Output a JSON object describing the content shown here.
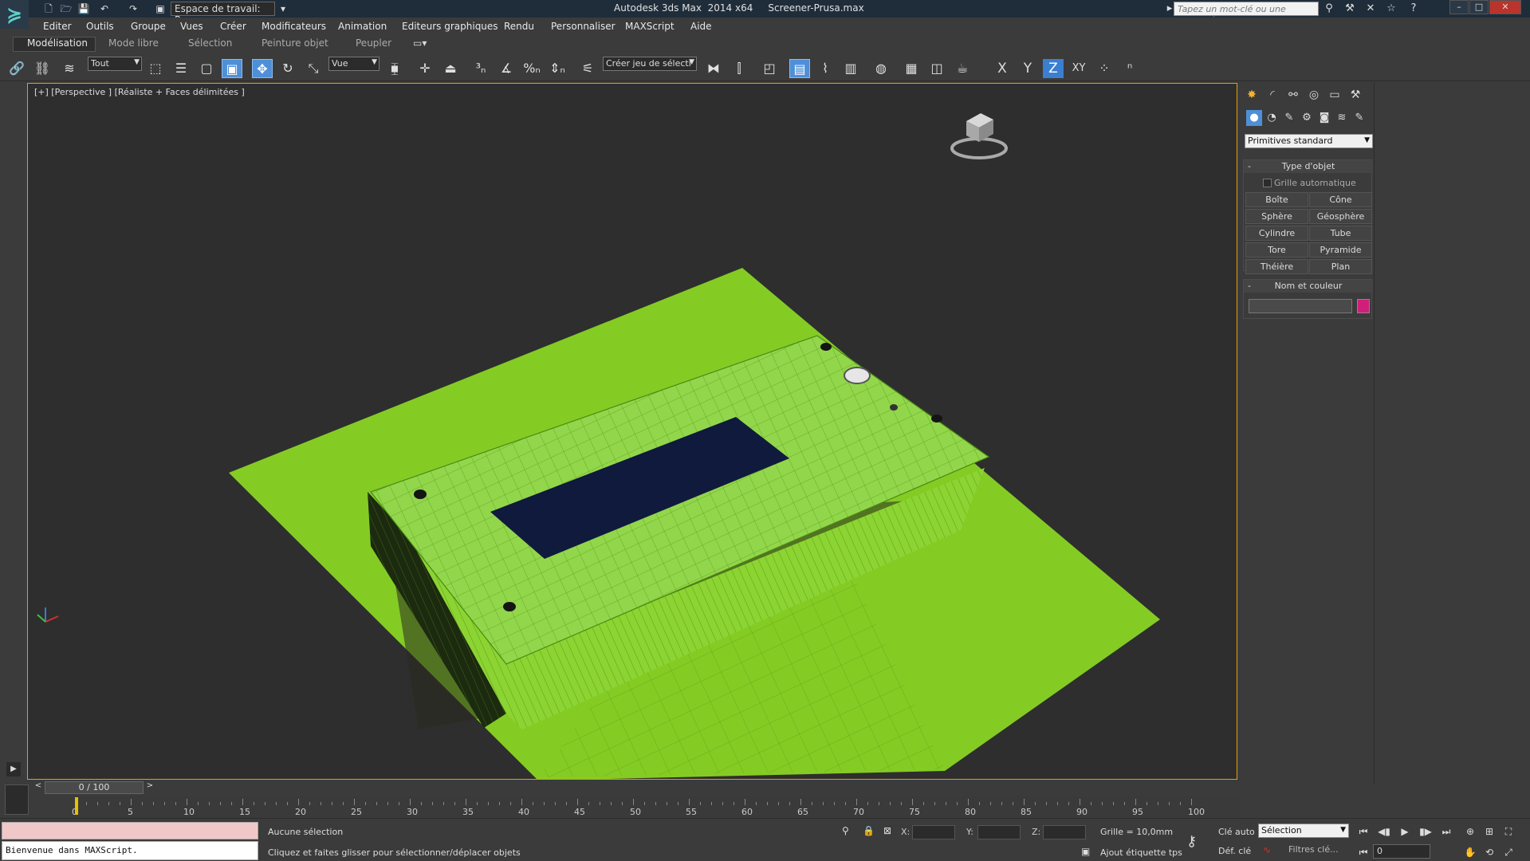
{
  "titlebar": {
    "workspace": "Espace de travail: Par",
    "app_title": "Autodesk 3ds Max  2014 x64     Screener-Prusa.max",
    "search_placeholder": "Tapez un mot-clé ou une expression"
  },
  "menu": [
    "Editer",
    "Outils",
    "Groupe",
    "Vues",
    "Créer",
    "Modificateurs",
    "Animation",
    "Editeurs graphiques",
    "Rendu",
    "Personnaliser",
    "MAXScript",
    "Aide"
  ],
  "ribbon_tabs": [
    "Modélisation",
    "Mode libre",
    "Sélection",
    "Peinture objet",
    "Peupler"
  ],
  "toolbar": {
    "filter_dropdown": "Tout",
    "ref_coord": "Vue",
    "named_selection": "Créer jeu de sélecti",
    "axes": [
      "X",
      "Y",
      "Z",
      "XY"
    ]
  },
  "viewport": {
    "label": "[+] [Perspective ] [Réaliste + Faces délimitées ]",
    "object_color": "#8fd13a",
    "ground_color": "#84cc24",
    "cutout_color": "#101a3c"
  },
  "command_panel": {
    "category": "Primitives standard",
    "rollout_object_type": "Type d'objet",
    "autogrid": "Grille automatique",
    "buttons": [
      "Boîte",
      "Cône",
      "Sphère",
      "Géosphère",
      "Cylindre",
      "Tube",
      "Tore",
      "Pyramide",
      "Théière",
      "Plan"
    ],
    "rollout_name_color": "Nom et couleur",
    "swatch_color": "#d01f7b"
  },
  "timeline": {
    "slider": "0 / 100",
    "ticks": [
      "0",
      "5",
      "10",
      "15",
      "20",
      "25",
      "30",
      "35",
      "40",
      "45",
      "50",
      "55",
      "60",
      "65",
      "70",
      "75",
      "80",
      "85",
      "90",
      "95",
      "100"
    ]
  },
  "status": {
    "maxscript_message": "Bienvenue dans MAXScript.",
    "selection": "Aucune sélection",
    "prompt": "Cliquez et faites glisser pour sélectionner/déplacer objets",
    "x_label": "X:",
    "y_label": "Y:",
    "z_label": "Z:",
    "grid": "Grille = 10,0mm",
    "add_time_tag": "Ajout étiquette tps",
    "auto_key": "Clé auto",
    "set_key": "Déf. clé",
    "selection_set": "Sélection",
    "key_filters": "Filtres clé...",
    "frame": "0"
  }
}
